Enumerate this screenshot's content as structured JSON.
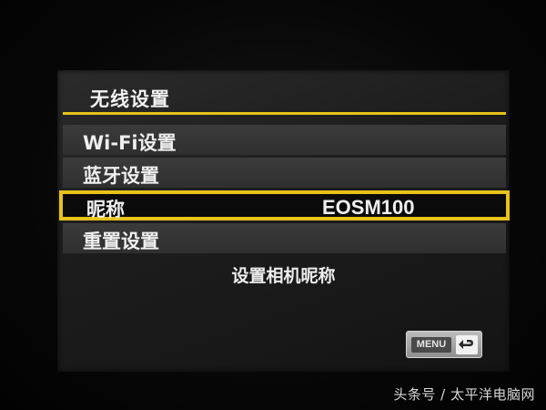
{
  "screen": {
    "title": "无线设置",
    "menu": {
      "items": [
        {
          "label": "Wi-Fi设置",
          "value": ""
        },
        {
          "label": "蓝牙设置",
          "value": ""
        },
        {
          "label": "昵称",
          "value": "EOSM100"
        },
        {
          "label": "重置设置",
          "value": ""
        }
      ],
      "selected_index": 2
    },
    "description": "设置相机昵称",
    "back_button": {
      "badge": "MENU",
      "icon": "return-arrow-icon"
    }
  },
  "watermark": {
    "text": "头条号 / 太平洋电脑网"
  },
  "colors": {
    "accent": "#e8c21a",
    "item_bg": "#343434",
    "screen_bg": "#1d1d1d"
  }
}
